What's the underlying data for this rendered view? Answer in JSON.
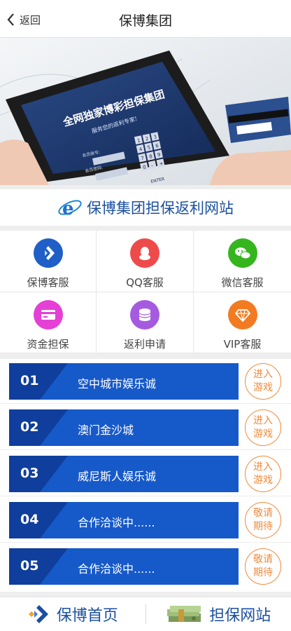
{
  "header": {
    "back_label": "返回",
    "title": "保博集团"
  },
  "banner": {
    "screen_title": "全网独家博彩担保集团",
    "screen_subtitle": "服务您的返利专家!",
    "field_1": "会员账号:",
    "field_2": "会员密码:",
    "keys": [
      "1",
      "2",
      "3",
      "4",
      "5",
      "6",
      "7",
      "8",
      "9",
      "0",
      "-",
      "+"
    ],
    "enter_key": "ENTER"
  },
  "brand": {
    "text": "保博集团担保返利网站"
  },
  "services": [
    {
      "label": "保博客服",
      "icon": "logo-icon",
      "color": "#1f5fc7"
    },
    {
      "label": "QQ客服",
      "icon": "qq-icon",
      "color": "#ef4a4a"
    },
    {
      "label": "微信客服",
      "icon": "wechat-icon",
      "color": "#35b51e"
    },
    {
      "label": "资金担保",
      "icon": "card-icon",
      "color": "#e53fd6"
    },
    {
      "label": "返利申请",
      "icon": "coins-icon",
      "color": "#a55bdf"
    },
    {
      "label": "VIP客服",
      "icon": "diamond-icon",
      "color": "#f27b22"
    }
  ],
  "sites": [
    {
      "num": "01",
      "name": "空中城市娱乐诚",
      "cta": "进入游戏"
    },
    {
      "num": "02",
      "name": "澳门金沙城",
      "cta": "进入游戏"
    },
    {
      "num": "03",
      "name": "威尼斯人娱乐诚",
      "cta": "进入游戏"
    },
    {
      "num": "04",
      "name": "合作洽谈中......",
      "cta": "敬请期待"
    },
    {
      "num": "05",
      "name": "合作洽谈中......",
      "cta": "敬请期待"
    }
  ],
  "footer": {
    "home_label": "保博首页",
    "guarantee_label": "担保网站"
  }
}
